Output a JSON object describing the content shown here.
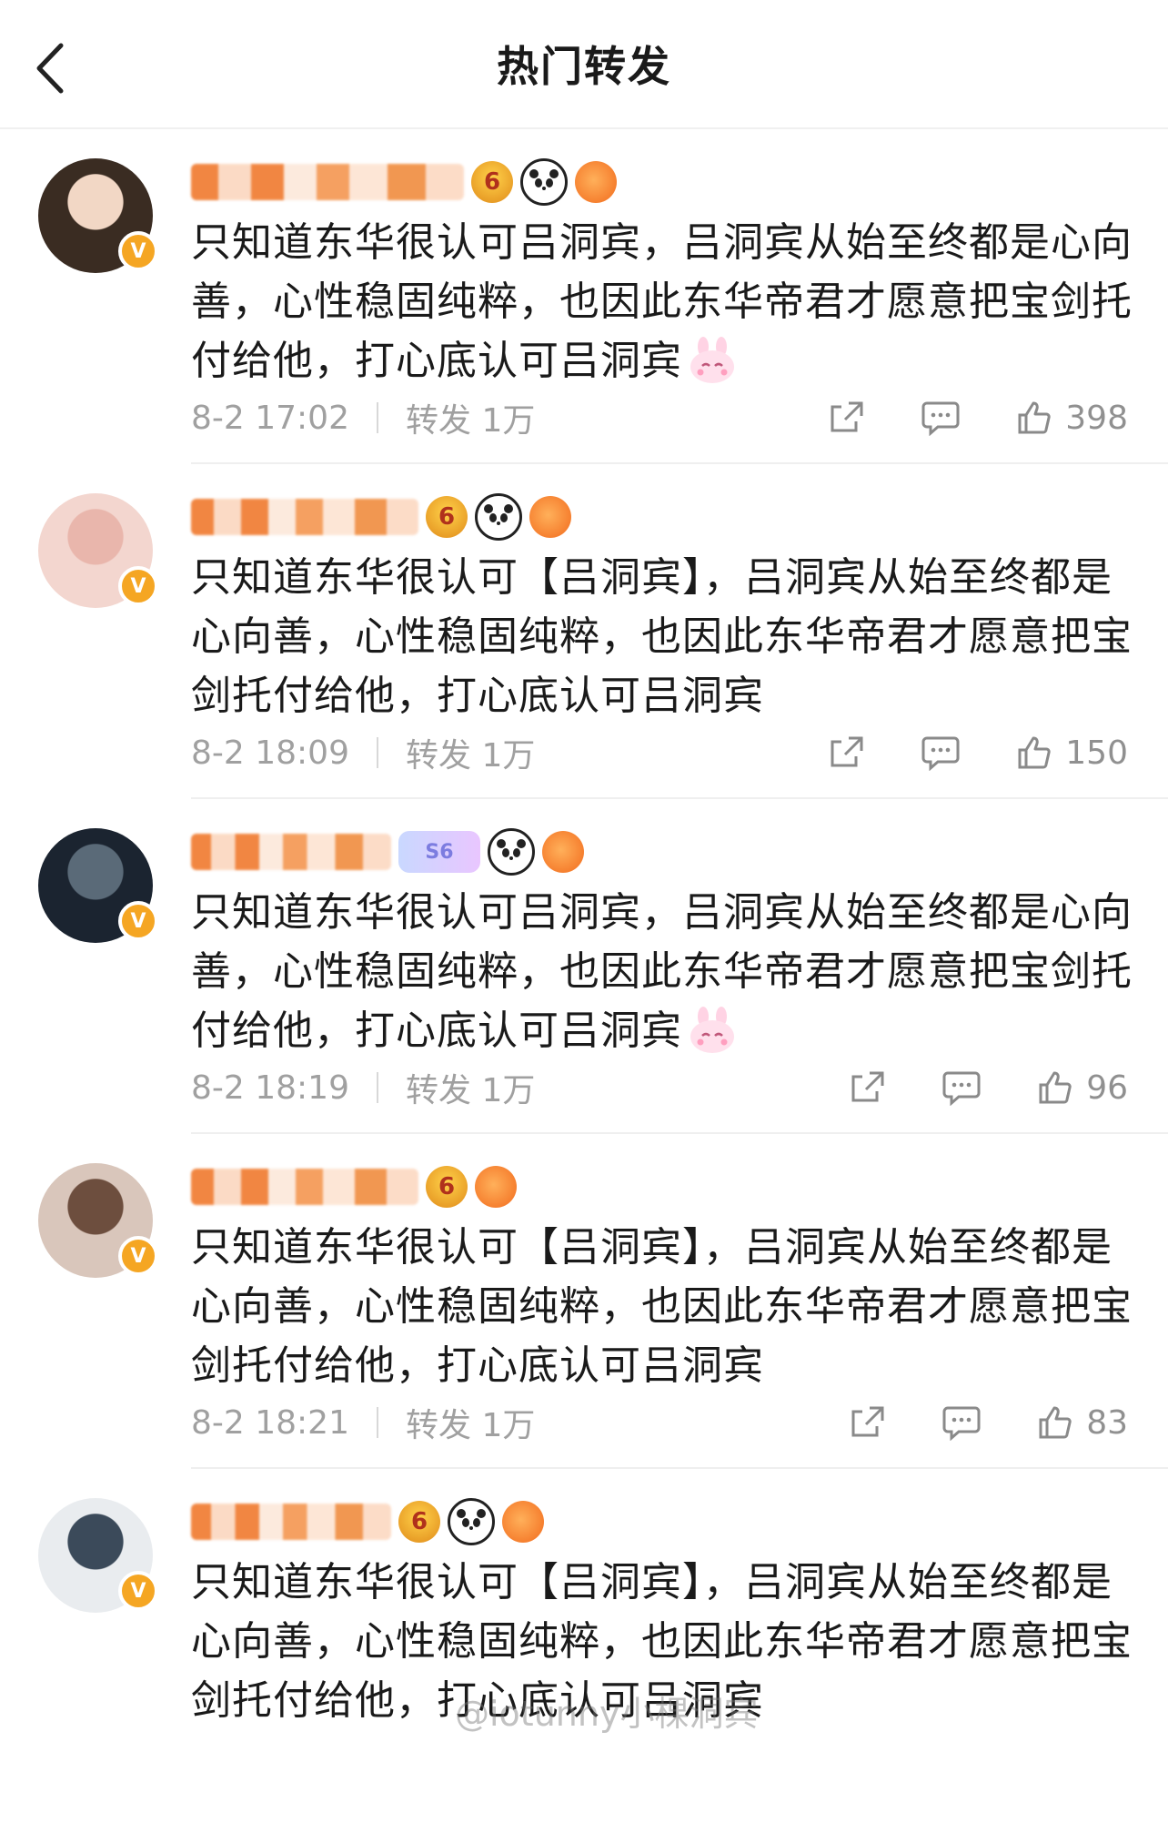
{
  "header": {
    "title": "热门转发"
  },
  "posts": [
    {
      "text": "只知道东华很认可吕洞宾，吕洞宾从始至终都是心向善，心性稳固纯粹，也因此东华帝君才愿意把宝剑托付给他，打心底认可吕洞宾",
      "has_bunny": true,
      "time": "8-2 17:02",
      "repost": "转发 1万",
      "likes": "398",
      "avatar_colors": [
        "#3a2c22",
        "#f2d7c5"
      ]
    },
    {
      "text": "只知道东华很认可【吕洞宾】，吕洞宾从始至终都是心向善，心性稳固纯粹，也因此东华帝君才愿意把宝剑托付给他，打心底认可吕洞宾",
      "has_bunny": false,
      "time": "8-2 18:09",
      "repost": "转发 1万",
      "likes": "150",
      "avatar_colors": [
        "#f3d6cf",
        "#e9b6ac"
      ]
    },
    {
      "text": "只知道东华很认可吕洞宾，吕洞宾从始至终都是心向善，心性稳固纯粹，也因此东华帝君才愿意把宝剑托付给他，打心底认可吕洞宾",
      "has_bunny": true,
      "time": "8-2 18:19",
      "repost": "转发 1万",
      "likes": "96",
      "avatar_colors": [
        "#1b2430",
        "#5a6a78"
      ]
    },
    {
      "text": "只知道东华很认可【吕洞宾】，吕洞宾从始至终都是心向善，心性稳固纯粹，也因此东华帝君才愿意把宝剑托付给他，打心底认可吕洞宾",
      "has_bunny": false,
      "time": "8-2 18:21",
      "repost": "转发 1万",
      "likes": "83",
      "avatar_colors": [
        "#d9c6bb",
        "#6d4e3e"
      ]
    },
    {
      "text": "只知道东华很认可【吕洞宾】，吕洞宾从始至终都是心向善，心性稳固纯粹，也因此东华帝君才愿意把宝剑托付给他，打心底认可吕洞宾",
      "has_bunny": false,
      "time": "",
      "repost": "",
      "likes": "",
      "avatar_colors": [
        "#e9ecef",
        "#3b4a5a"
      ]
    }
  ],
  "icons": {
    "back": "chevron-left-icon",
    "share": "share-icon",
    "comment": "comment-icon",
    "like": "thumbs-up-icon",
    "verified": "verified-badge-icon"
  },
  "colors": {
    "accent": "#f07a2e",
    "meta": "#a0a0a0",
    "badge": "#f5a623"
  }
}
